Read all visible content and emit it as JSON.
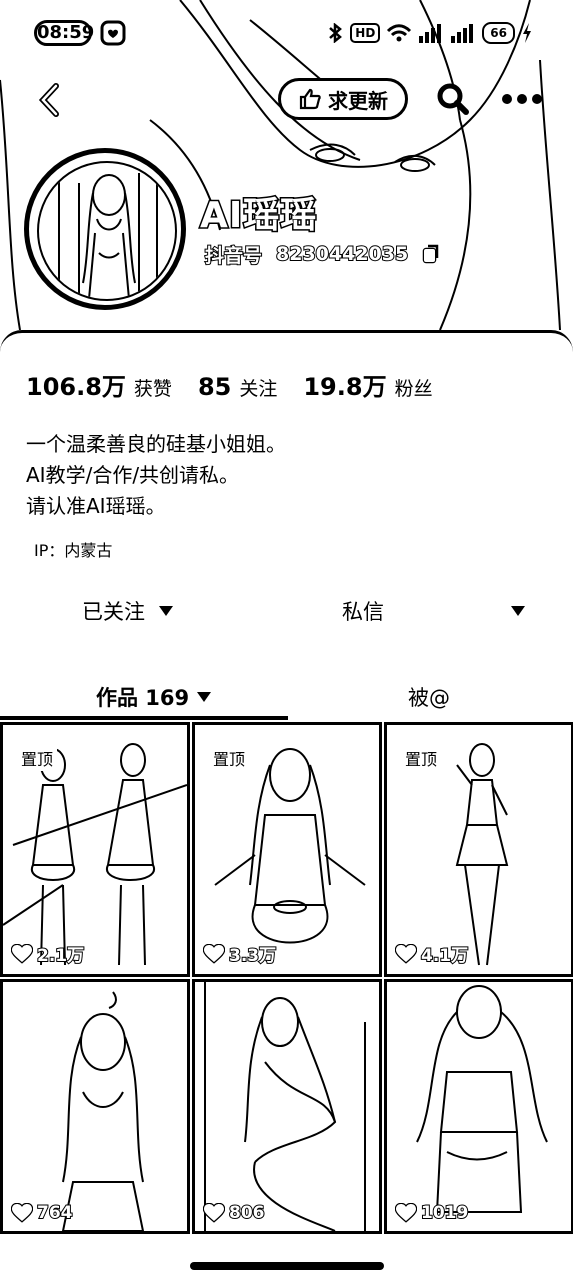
{
  "status_bar": {
    "time": "08:59",
    "hd_label": "HD",
    "battery": "66"
  },
  "nav": {
    "update_label": "求更新"
  },
  "profile": {
    "name": "AI瑶瑶",
    "douyin_id_label": "抖音号",
    "douyin_id": "8230442035"
  },
  "stats": [
    {
      "value": "106.8万",
      "label": "获赞"
    },
    {
      "value": "85",
      "label": "关注"
    },
    {
      "value": "19.8万",
      "label": "粉丝"
    }
  ],
  "bio": [
    "一个温柔善良的硅基小姐姐。",
    "AI教学/合作/共创请私。",
    "请认准AI瑶瑶。"
  ],
  "ip": "IP：内蒙古",
  "actions": {
    "follow_label": "已关注",
    "message_label": "私信"
  },
  "tabs": {
    "works_label": "作品 169",
    "mention_label": "被@"
  },
  "grid": [
    {
      "pinned": "置顶",
      "likes": "2.1万"
    },
    {
      "pinned": "置顶",
      "likes": "3.3万"
    },
    {
      "pinned": "置顶",
      "likes": "4.1万"
    },
    {
      "pinned": "",
      "likes": "764"
    },
    {
      "pinned": "",
      "likes": "806"
    },
    {
      "pinned": "",
      "likes": "1019"
    }
  ]
}
